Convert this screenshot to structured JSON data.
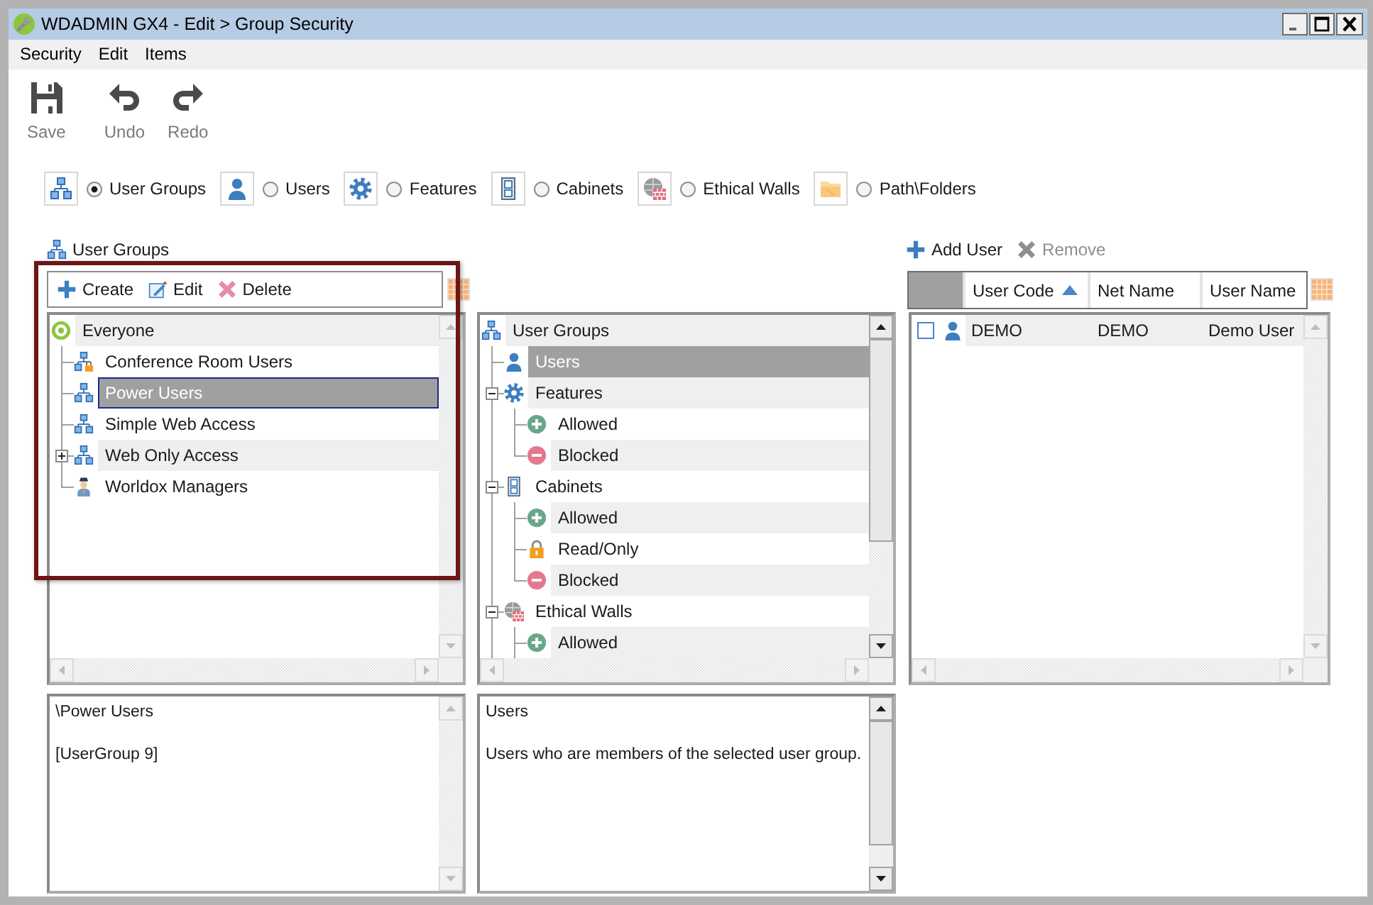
{
  "window": {
    "title": "WDADMIN GX4 - Edit > Group Security"
  },
  "menu": [
    "Security",
    "Edit",
    "Items"
  ],
  "toolbar": [
    {
      "kind": "save",
      "label": "Save"
    },
    {
      "kind": "undo",
      "label": "Undo"
    },
    {
      "kind": "redo",
      "label": "Redo"
    }
  ],
  "view_options": [
    {
      "kind": "group",
      "label": "User Groups",
      "selected": true
    },
    {
      "kind": "user",
      "label": "Users",
      "selected": false
    },
    {
      "kind": "feature",
      "label": "Features",
      "selected": false
    },
    {
      "kind": "cabinet",
      "label": "Cabinets",
      "selected": false
    },
    {
      "kind": "wall",
      "label": "Ethical Walls",
      "selected": false
    },
    {
      "kind": "folder",
      "label": "Path\\Folders",
      "selected": false
    }
  ],
  "groups_panel": {
    "title": "User Groups",
    "highlighted": true,
    "actions": [
      {
        "kind": "create",
        "label": "Create"
      },
      {
        "kind": "edit",
        "label": "Edit"
      },
      {
        "kind": "delete",
        "label": "Delete"
      }
    ],
    "tree": [
      {
        "kind": "everyone",
        "label": "Everyone",
        "selected": false,
        "children": [
          {
            "kind": "group-locked",
            "label": "Conference Room Users",
            "selected": false
          },
          {
            "kind": "group",
            "label": "Power Users",
            "selected": true
          },
          {
            "kind": "group",
            "label": "Simple Web Access",
            "selected": false
          },
          {
            "kind": "group",
            "label": "Web Only Access",
            "selected": false,
            "expanded": false
          },
          {
            "kind": "manager",
            "label": "Worldox Managers",
            "selected": false
          }
        ]
      }
    ],
    "details": [
      "\\Power Users",
      "[UserGroup 9]"
    ]
  },
  "rights_panel": {
    "tree": [
      {
        "kind": "group",
        "label": "User Groups",
        "selected": false,
        "children": [
          {
            "kind": "user",
            "label": "Users",
            "selected": true
          },
          {
            "kind": "feature",
            "label": "Features",
            "selected": false,
            "expanded": true,
            "children": [
              {
                "kind": "allowed",
                "label": "Allowed",
                "selected": false
              },
              {
                "kind": "blocked",
                "label": "Blocked",
                "selected": false
              }
            ]
          },
          {
            "kind": "cabinet",
            "label": "Cabinets",
            "selected": false,
            "expanded": true,
            "children": [
              {
                "kind": "allowed",
                "label": "Allowed",
                "selected": false
              },
              {
                "kind": "read-only",
                "label": "Read/Only",
                "selected": false
              },
              {
                "kind": "blocked",
                "label": "Blocked",
                "selected": false
              }
            ]
          },
          {
            "kind": "wall",
            "label": "Ethical Walls",
            "selected": false,
            "expanded": true,
            "children": [
              {
                "kind": "allowed",
                "label": "Allowed",
                "selected": false
              }
            ]
          }
        ]
      }
    ],
    "details": [
      "Users",
      "Users who are members of the selected user group."
    ]
  },
  "members_panel": {
    "actions": [
      {
        "kind": "add",
        "label": "Add User",
        "disabled": false
      },
      {
        "kind": "remove",
        "label": "Remove",
        "disabled": true
      }
    ],
    "table": {
      "columns": [
        {
          "label": "User Code",
          "sorted": true
        },
        {
          "label": "Net Name"
        },
        {
          "label": "User Name"
        }
      ],
      "rows": [
        {
          "kind": "user",
          "checked": false,
          "cells": [
            "DEMO",
            "DEMO",
            "Demo User"
          ]
        }
      ]
    }
  }
}
